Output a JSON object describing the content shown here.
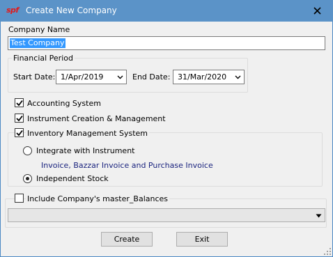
{
  "window": {
    "icon_text": "spf",
    "title": "Create New Company"
  },
  "form": {
    "company_name_label": "Company Name",
    "company_name_value": "Test Company",
    "financial_period": {
      "group_title": "Financial Period",
      "start_label": "Start Date:",
      "start_value": "1/Apr/2019",
      "end_label": "End Date:",
      "end_value": "31/Mar/2020"
    },
    "accounting": {
      "label": "Accounting System",
      "checked": true
    },
    "instrument": {
      "label": "Instrument Creation & Management",
      "checked": true
    },
    "inventory": {
      "label": "Inventory Management System",
      "checked": true,
      "options": [
        {
          "label": "Integrate with Instrument",
          "selected": false
        },
        {
          "label": "Independent Stock",
          "selected": true
        }
      ],
      "note": "Invoice, Bazzar Invoice and Purchase Invoice"
    },
    "master_balances": {
      "label": "Include Company's master_Balances",
      "checked": false,
      "selected_value": ""
    },
    "buttons": {
      "create": "Create",
      "exit": "Exit"
    }
  },
  "icons": [
    "app-logo-icon",
    "close-icon",
    "chevron-down-icon",
    "checkmark-icon",
    "size-grip-icon"
  ],
  "colors": {
    "titlebar": "#5b93c8",
    "dialog_bg": "#f0f0f0",
    "selection": "#3398ff",
    "note_text": "#1a237e",
    "app_icon": "#e21a1a"
  }
}
